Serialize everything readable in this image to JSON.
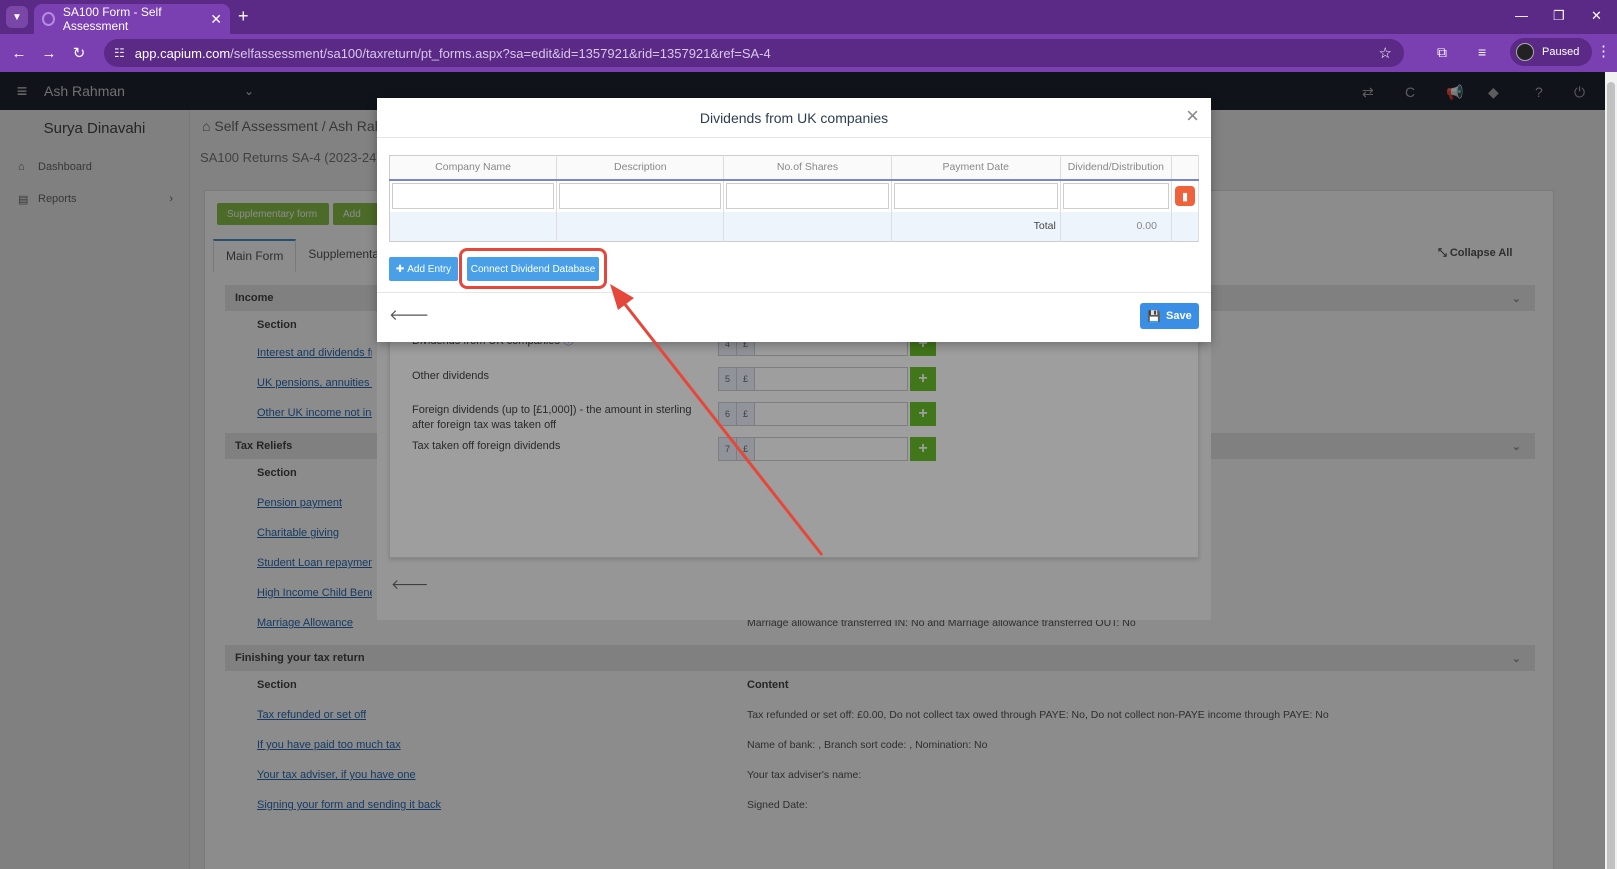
{
  "browser": {
    "tab_title": "SA100 Form - Self Assessment",
    "url_host": "app.capium.com",
    "url_path": "/selfassessment/sa100/taxreturn/pt_forms.aspx?sa=edit&id=1357921&rid=1357921&ref=SA-4",
    "profile_label": "Paused"
  },
  "app": {
    "user_name": "Ash Rahman",
    "client_name": "Surya Dinavahi",
    "sidebar": [
      {
        "label": "Dashboard"
      },
      {
        "label": "Reports"
      }
    ],
    "breadcrumb": "Self Assessment / Ash Rah",
    "page_title": "SA100 Returns SA-4 (2023-24)",
    "buttons": {
      "supplementary": "Supplementary form",
      "add": "Add"
    },
    "tabs": [
      "Main Form",
      "Supplementary"
    ],
    "collapse_all": "Collapse All",
    "sections": {
      "income": "Income",
      "tax_reliefs": "Tax Reliefs",
      "finishing": "Finishing your tax return"
    },
    "col_section": "Section",
    "col_content": "Content",
    "income_links": [
      "Interest and dividends fr",
      "UK pensions, annuities a",
      "Other UK income not inc"
    ],
    "relief_links": [
      "Pension payment",
      "Charitable giving",
      "Student Loan repayment",
      "High Income Child Benef",
      "Marriage Allowance"
    ],
    "marriage_content": "Marriage allowance transferred IN: No and Marriage allowance transferred OUT: No",
    "finishing_rows": [
      {
        "link": "Tax refunded or set off",
        "content": "Tax refunded or set off: £0.00, Do not collect tax owed through PAYE: No, Do not collect non-PAYE income through PAYE: No"
      },
      {
        "link": "If you have paid too much tax",
        "content": "Name of bank: , Branch sort code: , Nomination: No"
      },
      {
        "link": "Your tax adviser, if you have one",
        "content": "Your tax adviser's name:"
      },
      {
        "link": "Signing your form and sending it back",
        "content": "Signed Date:"
      }
    ]
  },
  "bg_modal": {
    "rows": [
      {
        "label": "Dividends from UK companies",
        "box": "4",
        "currency": "£"
      },
      {
        "label": "Other dividends",
        "box": "5",
        "currency": "£"
      },
      {
        "label": "Foreign dividends (up to [£1,000]) - the amount in sterling after foreign tax was taken off",
        "box": "6",
        "currency": "£"
      },
      {
        "label": "Tax taken off foreign dividends",
        "box": "7",
        "currency": "£"
      }
    ]
  },
  "modal": {
    "title": "Dividends from UK companies",
    "columns": [
      "Company Name",
      "Description",
      "No.of Shares",
      "Payment Date",
      "Dividend/Distribution"
    ],
    "total_label": "Total",
    "total_value": "0.00",
    "add_entry": "Add Entry",
    "connect": "Connect Dividend Database",
    "save": "Save"
  },
  "colors": {
    "browser_purple": "#7a3fb0",
    "highlight_red": "#e5483a",
    "button_blue": "#49a0e8",
    "green": "#8bc34a"
  }
}
